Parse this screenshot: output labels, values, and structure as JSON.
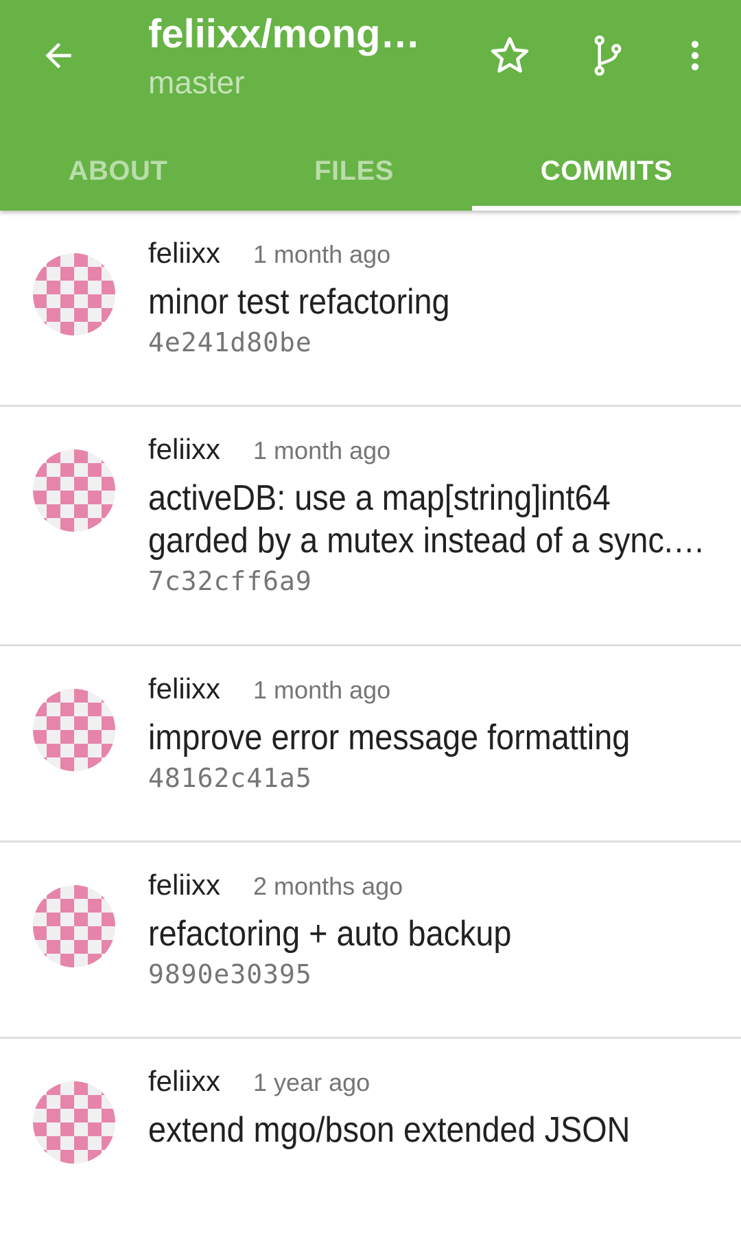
{
  "appbar": {
    "repo_title": "feliixx/mongo…",
    "branch": "master",
    "back_icon": "arrow-left-icon",
    "star_icon": "star-outline-icon",
    "branch_icon": "source-branch-icon",
    "overflow_icon": "more-vertical-icon"
  },
  "tabs": [
    {
      "label": "ABOUT",
      "active": false
    },
    {
      "label": "FILES",
      "active": false
    },
    {
      "label": "COMMITS",
      "active": true
    }
  ],
  "commits": [
    {
      "author": "feliixx",
      "time": "1 month ago",
      "message": "minor test refactoring",
      "sha": "4e241d80be"
    },
    {
      "author": "feliixx",
      "time": "1 month ago",
      "message": "activeDB: use a map[string]int64 garded by a mutex instead of a sync.…",
      "sha": "7c32cff6a9"
    },
    {
      "author": "feliixx",
      "time": "1 month ago",
      "message": "improve error message formatting",
      "sha": "48162c41a5"
    },
    {
      "author": "feliixx",
      "time": "2 months ago",
      "message": "refactoring + auto backup",
      "sha": "9890e30395"
    },
    {
      "author": "feliixx",
      "time": "1 year ago",
      "message": "extend mgo/bson extended JSON",
      "sha": ""
    }
  ],
  "colors": {
    "appbar": "#67b346",
    "avatar_pink": "#e684aa"
  }
}
